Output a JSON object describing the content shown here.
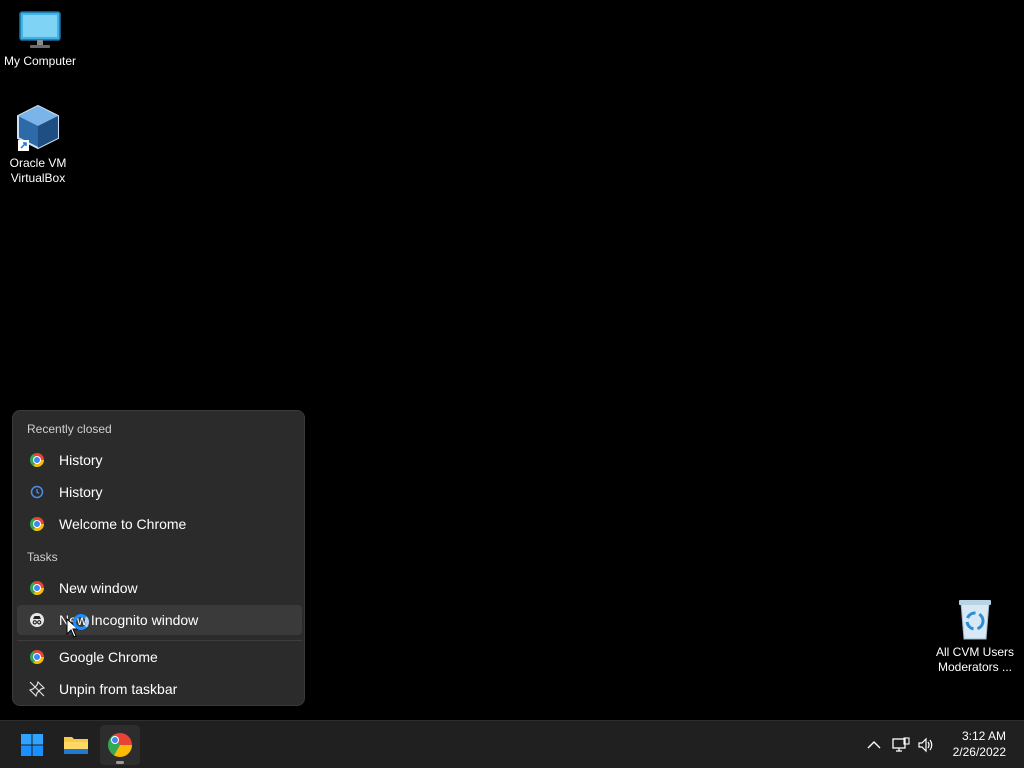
{
  "desktop": {
    "icons": [
      {
        "label": "My Computer",
        "icon": "monitor-icon"
      },
      {
        "label_line1": "Oracle VM",
        "label_line2": "VirtualBox",
        "icon": "virtualbox-icon"
      },
      {
        "label_line1": "All CVM Users",
        "label_line2": "Moderators ...",
        "icon": "recycle-bin-icon"
      }
    ]
  },
  "jumplist": {
    "recently_closed_header": "Recently closed",
    "recently_closed": [
      {
        "label": "History",
        "icon": "chrome-icon"
      },
      {
        "label": "History",
        "icon": "history-icon"
      },
      {
        "label": "Welcome to Chrome",
        "icon": "chrome-icon"
      }
    ],
    "tasks_header": "Tasks",
    "tasks": [
      {
        "label": "New window",
        "icon": "chrome-icon"
      },
      {
        "label": "New Incognito window",
        "icon": "incognito-icon"
      }
    ],
    "app": {
      "label": "Google Chrome",
      "icon": "chrome-icon"
    },
    "unpin": {
      "label": "Unpin from taskbar",
      "icon": "unpin-icon"
    }
  },
  "taskbar": {
    "apps": [
      {
        "name": "Start",
        "icon": "windows-start-icon"
      },
      {
        "name": "File Explorer",
        "icon": "folder-icon"
      },
      {
        "name": "Google Chrome",
        "icon": "chrome-icon",
        "active": true
      }
    ],
    "tray": [
      "chevron-up-icon",
      "network-icon",
      "volume-icon"
    ],
    "clock": {
      "time": "3:12 AM",
      "date": "2/26/2022"
    }
  },
  "colors": {
    "accent": "#1a8fff",
    "menu_bg": "#2b2b2b",
    "taskbar_bg": "#202020"
  }
}
